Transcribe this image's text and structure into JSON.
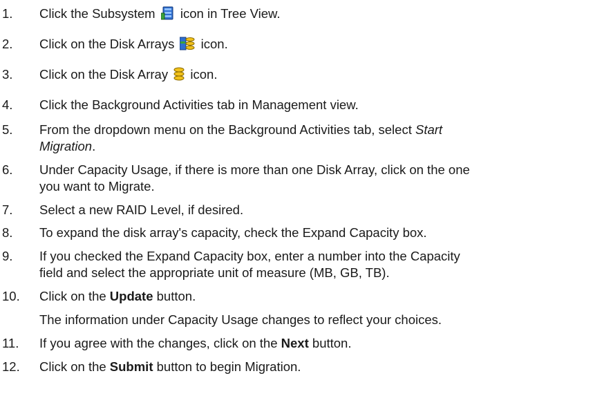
{
  "steps": [
    {
      "num": "1.",
      "a": "Click the Subsystem",
      "icon": "subsystem-icon",
      "b": "icon in Tree View."
    },
    {
      "num": "2.",
      "a": "Click on the Disk Arrays",
      "icon": "disk-arrays-icon",
      "b": "icon."
    },
    {
      "num": "3.",
      "a": "Click on the Disk Array",
      "icon": "disk-array-icon",
      "b": "icon."
    },
    {
      "num": "4.",
      "text": "Click the Background Activities tab in Management view."
    },
    {
      "num": "5.",
      "a": "From the dropdown menu on the Background Activities tab, select",
      "em1": "Start",
      "em2": "Migration",
      "b": "."
    },
    {
      "num": "6.",
      "line1": "Under Capacity Usage, if there is more than one Disk Array, click on the one",
      "line2": "you want to Migrate."
    },
    {
      "num": "7.",
      "text": "Select a new RAID Level, if desired."
    },
    {
      "num": "8.",
      "text": "To expand the disk array's capacity, check the Expand Capacity box."
    },
    {
      "num": "9.",
      "line1": "If you checked the Expand Capacity box, enter a number into the Capacity",
      "line2": "field and select the appropriate unit of measure (MB, GB, TB)."
    },
    {
      "num": "10.",
      "a": "Click on the",
      "strong": "Update",
      "b": "button.",
      "note": "The information under Capacity Usage changes to reflect your choices."
    },
    {
      "num": "11.",
      "a": "If you agree with the changes, click on the",
      "strong": "Next",
      "b": "button."
    },
    {
      "num": "12.",
      "a": "Click on the",
      "strong": "Submit",
      "b": "button to begin Migration."
    }
  ],
  "colors": {
    "text": "#1a1a1a",
    "icon_blue": "#2f6fcf",
    "icon_yellow": "#f2c21a",
    "icon_green": "#3aa33a"
  }
}
